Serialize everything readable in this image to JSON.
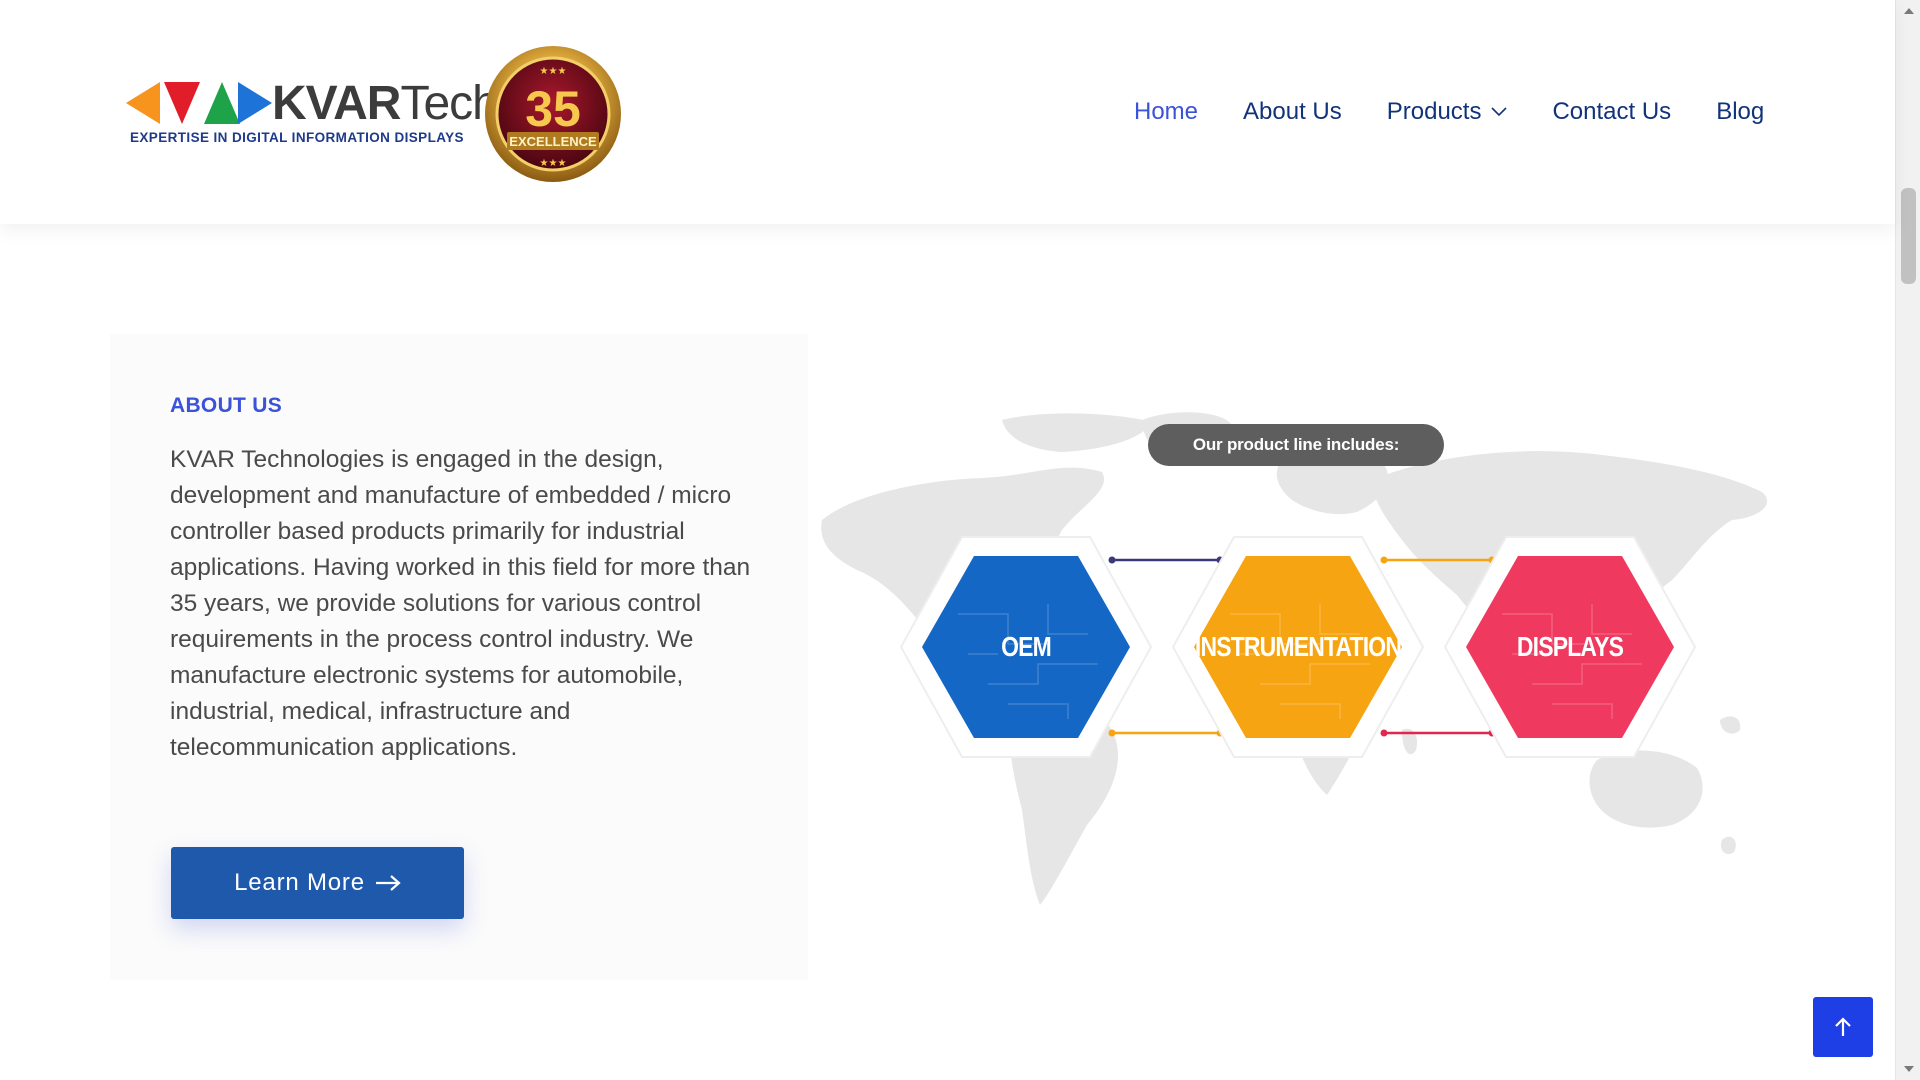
{
  "brand": {
    "word_bold": "KVAR",
    "word_light": "Tech",
    "tagline": "EXPERTISE IN DIGITAL INFORMATION DISPLAYS",
    "badge_number": "35",
    "badge_text": "EXCELLENCE",
    "triangle_colors": [
      "#f7941d",
      "#e11d2a",
      "#1fa34a",
      "#1e73d8"
    ]
  },
  "nav": {
    "items": [
      {
        "label": "Home",
        "active": true
      },
      {
        "label": "About Us",
        "active": false
      },
      {
        "label": "Products",
        "active": false,
        "has_dropdown": true,
        "icon": "chevron-down-icon"
      },
      {
        "label": "Contact Us",
        "active": false
      },
      {
        "label": "Blog",
        "active": false
      }
    ]
  },
  "about": {
    "label": "ABOUT US",
    "body": "KVAR Technologies is engaged in the design, development and manufacture of embedded / micro controller based products primarily for industrial applications. Having worked in this field for more than 35 years, we provide solutions for various control requirements in the process control industry. We manufacture electronic systems for automobile, industrial, medical, infrastructure and telecommunication applications.",
    "button_label": "Learn More",
    "button_icon": "arrow-right-icon"
  },
  "infographic": {
    "heading": "Our product line includes:",
    "products": [
      {
        "label": "OEM",
        "color": "#1467c4"
      },
      {
        "label": "INSTRUMENTATION",
        "color": "#f7a412"
      },
      {
        "label": "DISPLAYS",
        "color": "#f0395f"
      }
    ]
  },
  "back_to_top": {
    "icon": "arrow-up-icon"
  },
  "colors": {
    "nav_text": "#12337a",
    "nav_active": "#3b52d9",
    "accent_label": "#3b52d9",
    "button_bg": "#1f59ac",
    "back_to_top_bg": "#1f3fe6"
  }
}
